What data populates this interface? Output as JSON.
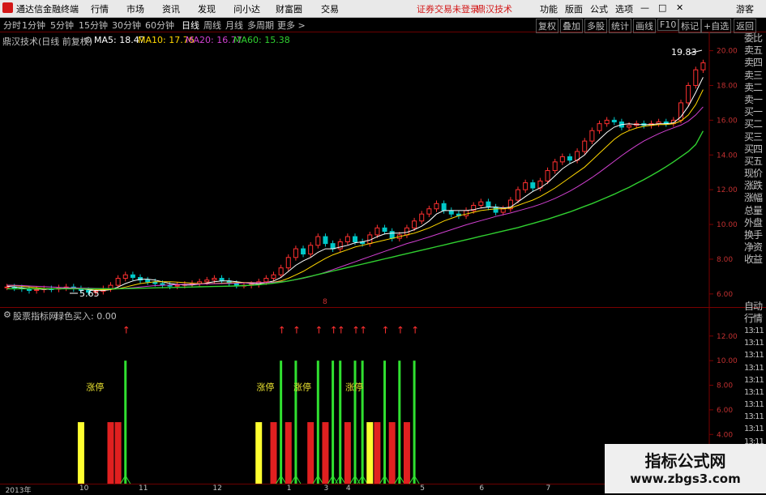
{
  "menubar": {
    "app_title": "通达信金融终端",
    "menus": [
      "行情",
      "市场",
      "资讯",
      "发现",
      "问小达",
      "财富圈",
      "交易"
    ],
    "status": "证券交易未登录",
    "stock_name": "鼎汉技术",
    "right_buttons": [
      "功能",
      "版面",
      "公式",
      "选项"
    ],
    "guest": "游客",
    "win_controls": [
      "—",
      "□",
      "✕"
    ]
  },
  "toolbar": {
    "periods": [
      "分时",
      "1分钟",
      "5分钟",
      "15分钟",
      "30分钟",
      "60分钟",
      "日线",
      "周线",
      "月线",
      "多周期",
      "更多 >"
    ],
    "active_period": "日线",
    "right_buttons": [
      "复权",
      "叠加",
      "多股",
      "统计",
      "画线",
      "F10",
      "标记",
      "+自选",
      "返回"
    ]
  },
  "main_chart": {
    "title": "鼎汉技术(日线 前复权)",
    "ma_labels": [
      {
        "text": "MA5: 18.47",
        "color": "#ffffff"
      },
      {
        "text": "MA10: 17.76",
        "color": "#ffd700"
      },
      {
        "text": "MA20: 16.77",
        "color": "#d040d0"
      },
      {
        "text": "MA60: 15.38",
        "color": "#30d030"
      }
    ],
    "high_marker": "19.83",
    "low_marker": "5.65",
    "center_marker": "8"
  },
  "indicator": {
    "title": "股票指标网",
    "value_label": "绿色买入: 0.00",
    "signal_label": "涨停"
  },
  "right_panel": {
    "quote_labels": [
      "委比",
      "卖五",
      "卖四",
      "卖三",
      "卖二",
      "卖一",
      "买一",
      "买二",
      "买三",
      "买四",
      "买五",
      "现价",
      "涨跌",
      "涨幅",
      "总量",
      "外盘",
      "换手",
      "净资",
      "收益"
    ],
    "lower_labels": [
      "自动",
      "行情",
      "13:11",
      "13:11",
      "13:11",
      "13:11",
      "13:11",
      "13:11",
      "13:11",
      "13:11",
      "13:11",
      "13:11"
    ]
  },
  "chart_data": [
    {
      "type": "line",
      "name": "price",
      "ylim": [
        5.2,
        20.4
      ],
      "ticks": [
        6,
        8,
        10,
        12,
        14,
        16,
        18,
        20
      ],
      "tick_labels": [
        "6.00",
        "8.00",
        "10.00",
        "12.00",
        "14.00",
        "16.00",
        "18.00",
        "20.00"
      ],
      "close": [
        6.4,
        6.35,
        6.3,
        6.2,
        6.25,
        6.3,
        6.28,
        6.35,
        6.4,
        6.3,
        6.2,
        6.1,
        6.15,
        6.3,
        6.5,
        6.9,
        7.1,
        6.95,
        6.8,
        6.7,
        6.6,
        6.5,
        6.45,
        6.5,
        6.55,
        6.6,
        6.7,
        6.8,
        6.9,
        6.75,
        6.6,
        6.5,
        6.5,
        6.55,
        6.7,
        6.9,
        7.1,
        7.5,
        8.1,
        8.6,
        8.3,
        8.8,
        9.3,
        8.9,
        8.6,
        9.0,
        9.3,
        9.0,
        8.9,
        9.4,
        9.8,
        9.6,
        9.2,
        9.4,
        9.8,
        10.2,
        10.6,
        10.9,
        11.2,
        10.8,
        10.6,
        10.5,
        10.8,
        11.1,
        11.3,
        11.0,
        10.7,
        10.9,
        11.4,
        12.0,
        12.4,
        12.1,
        12.5,
        13.1,
        13.6,
        13.9,
        13.7,
        14.2,
        14.8,
        15.4,
        15.8,
        16.0,
        15.9,
        15.6,
        15.7,
        15.8,
        15.7,
        15.8,
        15.9,
        15.8,
        16.0,
        17.0,
        18.0,
        18.9,
        19.3
      ],
      "series": [
        {
          "name": "MA5",
          "values": [
            6.45,
            6.4,
            6.35,
            6.3,
            6.28,
            6.27,
            6.28,
            6.3,
            6.32,
            6.33,
            6.3,
            6.25,
            6.2,
            6.2,
            6.25,
            6.4,
            6.6,
            6.75,
            6.85,
            6.85,
            6.8,
            6.7,
            6.6,
            6.55,
            6.52,
            6.52,
            6.56,
            6.63,
            6.7,
            6.75,
            6.75,
            6.7,
            6.65,
            6.6,
            6.58,
            6.65,
            6.75,
            6.95,
            7.3,
            7.65,
            7.9,
            8.1,
            8.4,
            8.6,
            8.6,
            8.7,
            8.8,
            8.95,
            9.0,
            9.1,
            9.3,
            9.45,
            9.5,
            9.5,
            9.55,
            9.7,
            9.9,
            10.2,
            10.6,
            10.8,
            10.8,
            10.8,
            10.8,
            10.85,
            10.95,
            11.0,
            11.0,
            10.95,
            11.0,
            11.3,
            11.6,
            11.9,
            12.1,
            12.4,
            12.8,
            13.2,
            13.5,
            13.7,
            14.0,
            14.5,
            14.9,
            15.3,
            15.6,
            15.75,
            15.8,
            15.75,
            15.75,
            15.75,
            15.8,
            15.8,
            15.85,
            16.2,
            16.8,
            17.6,
            18.47
          ]
        },
        {
          "name": "MA10",
          "values": [
            6.5,
            6.48,
            6.45,
            6.4,
            6.36,
            6.32,
            6.3,
            6.3,
            6.3,
            6.3,
            6.3,
            6.28,
            6.26,
            6.25,
            6.26,
            6.3,
            6.4,
            6.5,
            6.6,
            6.65,
            6.7,
            6.7,
            6.7,
            6.68,
            6.65,
            6.62,
            6.6,
            6.6,
            6.6,
            6.62,
            6.64,
            6.65,
            6.66,
            6.66,
            6.65,
            6.65,
            6.68,
            6.75,
            6.9,
            7.1,
            7.3,
            7.55,
            7.8,
            8.05,
            8.25,
            8.4,
            8.55,
            8.7,
            8.8,
            8.9,
            9.0,
            9.1,
            9.2,
            9.3,
            9.4,
            9.5,
            9.65,
            9.8,
            10.0,
            10.2,
            10.35,
            10.5,
            10.6,
            10.7,
            10.8,
            10.85,
            10.9,
            10.9,
            10.95,
            11.1,
            11.25,
            11.4,
            11.6,
            11.85,
            12.1,
            12.4,
            12.7,
            13.0,
            13.3,
            13.7,
            14.1,
            14.5,
            14.9,
            15.2,
            15.4,
            15.55,
            15.65,
            15.7,
            15.75,
            15.75,
            15.8,
            15.95,
            16.3,
            16.9,
            17.76
          ]
        },
        {
          "name": "MA20",
          "values": [
            6.5,
            6.5,
            6.48,
            6.46,
            6.44,
            6.42,
            6.4,
            6.38,
            6.36,
            6.35,
            6.34,
            6.33,
            6.32,
            6.31,
            6.3,
            6.31,
            6.33,
            6.36,
            6.4,
            6.44,
            6.48,
            6.5,
            6.52,
            6.54,
            6.55,
            6.56,
            6.57,
            6.58,
            6.59,
            6.6,
            6.61,
            6.62,
            6.63,
            6.64,
            6.65,
            6.66,
            6.67,
            6.7,
            6.75,
            6.82,
            6.9,
            7.0,
            7.12,
            7.25,
            7.4,
            7.55,
            7.7,
            7.85,
            8.0,
            8.15,
            8.3,
            8.45,
            8.6,
            8.75,
            8.9,
            9.02,
            9.15,
            9.28,
            9.42,
            9.56,
            9.7,
            9.84,
            9.98,
            10.1,
            10.22,
            10.34,
            10.46,
            10.56,
            10.66,
            10.78,
            10.9,
            11.02,
            11.16,
            11.32,
            11.5,
            11.7,
            11.92,
            12.16,
            12.42,
            12.7,
            13.0,
            13.32,
            13.64,
            13.96,
            14.26,
            14.54,
            14.8,
            15.02,
            15.22,
            15.4,
            15.56,
            15.72,
            15.95,
            16.3,
            16.77
          ]
        },
        {
          "name": "MA60",
          "values": [
            6.3,
            6.3,
            6.3,
            6.3,
            6.3,
            6.3,
            6.3,
            6.3,
            6.3,
            6.3,
            6.3,
            6.3,
            6.3,
            6.3,
            6.3,
            6.3,
            6.31,
            6.32,
            6.33,
            6.34,
            6.35,
            6.36,
            6.37,
            6.38,
            6.39,
            6.4,
            6.41,
            6.42,
            6.43,
            6.44,
            6.45,
            6.46,
            6.48,
            6.5,
            6.53,
            6.57,
            6.62,
            6.68,
            6.75,
            6.83,
            6.92,
            7.02,
            7.12,
            7.22,
            7.32,
            7.42,
            7.52,
            7.62,
            7.72,
            7.82,
            7.92,
            8.02,
            8.12,
            8.22,
            8.32,
            8.42,
            8.52,
            8.62,
            8.72,
            8.82,
            8.92,
            9.02,
            9.12,
            9.22,
            9.32,
            9.42,
            9.52,
            9.62,
            9.72,
            9.82,
            9.94,
            10.06,
            10.18,
            10.3,
            10.44,
            10.58,
            10.72,
            10.88,
            11.04,
            11.2,
            11.38,
            11.56,
            11.74,
            11.94,
            12.14,
            12.36,
            12.58,
            12.82,
            13.06,
            13.32,
            13.6,
            13.9,
            14.2,
            14.6,
            15.38
          ]
        }
      ]
    },
    {
      "type": "bar",
      "name": "indicator",
      "ylim": [
        0,
        13.5
      ],
      "ticks": [
        2,
        4,
        6,
        8,
        10,
        12
      ],
      "tick_labels": [
        "2.00",
        "4.00",
        "6.00",
        "8.00",
        "10.00",
        "12.00"
      ],
      "bars": [
        {
          "i": 10,
          "v": 5,
          "c": "yellow"
        },
        {
          "i": 14,
          "v": 5,
          "c": "red"
        },
        {
          "i": 15,
          "v": 5,
          "c": "red"
        },
        {
          "i": 16,
          "v": 10,
          "c": "green"
        },
        {
          "i": 34,
          "v": 5,
          "c": "yellow"
        },
        {
          "i": 36,
          "v": 5,
          "c": "red"
        },
        {
          "i": 37,
          "v": 10,
          "c": "green"
        },
        {
          "i": 38,
          "v": 5,
          "c": "red"
        },
        {
          "i": 39,
          "v": 10,
          "c": "green"
        },
        {
          "i": 41,
          "v": 5,
          "c": "red"
        },
        {
          "i": 42,
          "v": 10,
          "c": "green"
        },
        {
          "i": 43,
          "v": 5,
          "c": "red"
        },
        {
          "i": 44,
          "v": 10,
          "c": "green"
        },
        {
          "i": 45,
          "v": 10,
          "c": "green"
        },
        {
          "i": 46,
          "v": 5,
          "c": "red"
        },
        {
          "i": 47,
          "v": 10,
          "c": "green"
        },
        {
          "i": 48,
          "v": 10,
          "c": "green"
        },
        {
          "i": 49,
          "v": 5,
          "c": "yellow"
        },
        {
          "i": 50,
          "v": 5,
          "c": "red"
        },
        {
          "i": 51,
          "v": 10,
          "c": "green"
        },
        {
          "i": 52,
          "v": 5,
          "c": "red"
        },
        {
          "i": 53,
          "v": 10,
          "c": "green"
        },
        {
          "i": 54,
          "v": 5,
          "c": "red"
        },
        {
          "i": 55,
          "v": 10,
          "c": "green"
        }
      ],
      "limit_labels_at": [
        12,
        35,
        40,
        47
      ],
      "arrows_at": [
        16,
        37,
        39,
        42,
        44,
        45,
        47,
        48,
        51,
        53,
        55
      ]
    }
  ],
  "x_axis": {
    "labels": [
      {
        "text": "2013年",
        "i": 0
      },
      {
        "text": "10",
        "i": 10
      },
      {
        "text": "11",
        "i": 18
      },
      {
        "text": "12",
        "i": 28
      },
      {
        "text": "1",
        "i": 38
      },
      {
        "text": "3",
        "i": 43
      },
      {
        "text": "4",
        "i": 46
      },
      {
        "text": "5",
        "i": 56
      },
      {
        "text": "6",
        "i": 64
      },
      {
        "text": "7",
        "i": 73
      },
      {
        "text": "8",
        "i": 83
      },
      {
        "text": "9",
        "i": 92
      }
    ]
  },
  "watermark": {
    "line1": "指标公式网",
    "line2": "www.zbgs3.com"
  },
  "colors": {
    "up": "#ff3030",
    "down": "#00c8c8",
    "grid": "#7a0000",
    "ma5": "#ffffff",
    "ma10": "#ffd700",
    "ma20": "#d040d0",
    "ma60": "#30d030",
    "yellow_bar": "#ffff30",
    "red_bar": "#e02020",
    "green_bar": "#30e030"
  }
}
